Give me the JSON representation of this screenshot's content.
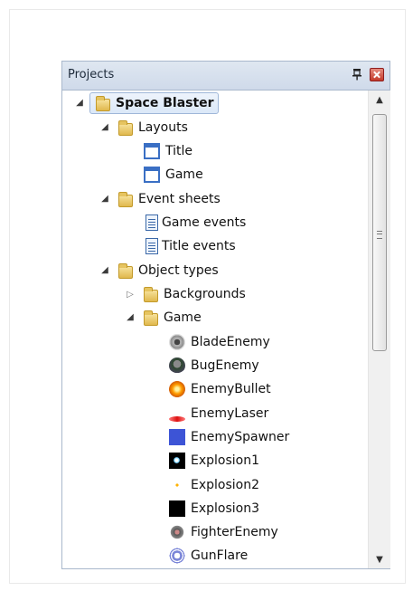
{
  "panel": {
    "title": "Projects"
  },
  "tree": [
    {
      "label": "Space Blaster",
      "icon": "folder-icon",
      "expanded": true,
      "root": true
    },
    {
      "label": "Layouts",
      "icon": "folder-icon",
      "expanded": true
    },
    {
      "label": "Title",
      "icon": "layout-icon"
    },
    {
      "label": "Game",
      "icon": "layout-icon"
    },
    {
      "label": "Event sheets",
      "icon": "folder-icon",
      "expanded": true
    },
    {
      "label": "Game events",
      "icon": "event-sheet-icon"
    },
    {
      "label": "Title events",
      "icon": "event-sheet-icon"
    },
    {
      "label": "Object types",
      "icon": "folder-icon",
      "expanded": true
    },
    {
      "label": "Backgrounds",
      "icon": "folder-icon",
      "expanded": false
    },
    {
      "label": "Game",
      "icon": "folder-icon",
      "expanded": true
    },
    {
      "label": "BladeEnemy",
      "icon": "blade-enemy-icon"
    },
    {
      "label": "BugEnemy",
      "icon": "bug-enemy-icon"
    },
    {
      "label": "EnemyBullet",
      "icon": "enemy-bullet-icon"
    },
    {
      "label": "EnemyLaser",
      "icon": "enemy-laser-icon"
    },
    {
      "label": "EnemySpawner",
      "icon": "enemy-spawner-icon"
    },
    {
      "label": "Explosion1",
      "icon": "explosion1-icon"
    },
    {
      "label": "Explosion2",
      "icon": "explosion2-icon"
    },
    {
      "label": "Explosion3",
      "icon": "explosion3-icon"
    },
    {
      "label": "FighterEnemy",
      "icon": "fighter-enemy-icon"
    },
    {
      "label": "GunFlare",
      "icon": "gun-flare-icon"
    }
  ],
  "scrollbar": {
    "position_fraction": 0.0
  },
  "colors": {
    "titlebar": "#dfe7f1",
    "selection_border": "#9fb7d9",
    "folder": "#e0b84d"
  }
}
